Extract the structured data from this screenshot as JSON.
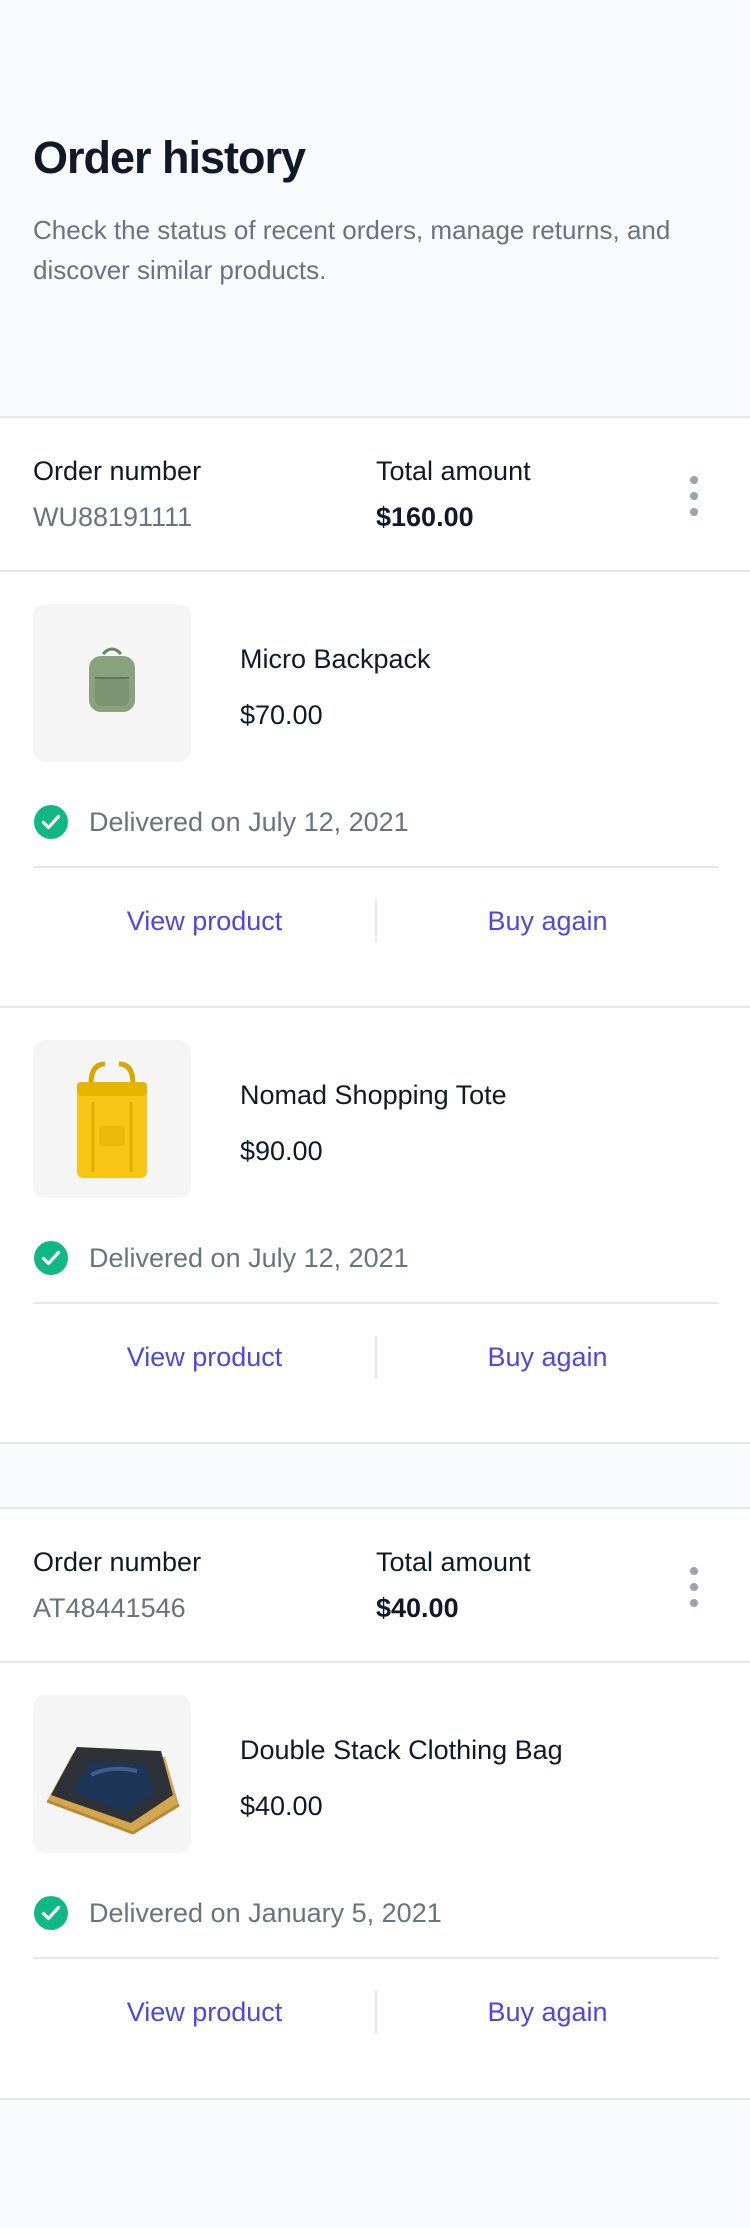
{
  "header": {
    "title": "Order history",
    "subtitle": "Check the status of recent orders, manage returns, and discover similar products."
  },
  "orders": [
    {
      "number_label": "Order number",
      "number": "WU88191111",
      "total_label": "Total amount",
      "total": "$160.00",
      "items": [
        {
          "name": "Micro Backpack",
          "price": "$70.00",
          "image_icon": "green-backpack-image",
          "status": "Delivered on July 12, 2021",
          "view_label": "View product",
          "buy_label": "Buy again"
        },
        {
          "name": "Nomad Shopping Tote",
          "price": "$90.00",
          "image_icon": "yellow-tote-image",
          "status": "Delivered on July 12, 2021",
          "view_label": "View product",
          "buy_label": "Buy again"
        }
      ]
    },
    {
      "number_label": "Order number",
      "number": "AT48441546",
      "total_label": "Total amount",
      "total": "$40.00",
      "items": [
        {
          "name": "Double Stack Clothing Bag",
          "price": "$40.00",
          "image_icon": "clothing-bag-image",
          "status": "Delivered on January 5, 2021",
          "view_label": "View product",
          "buy_label": "Buy again"
        }
      ]
    }
  ],
  "colors": {
    "accent": "#4f46e5",
    "success": "#10b981",
    "muted": "#6b7280",
    "border": "#e5e7eb",
    "background": "#f9fafb"
  }
}
